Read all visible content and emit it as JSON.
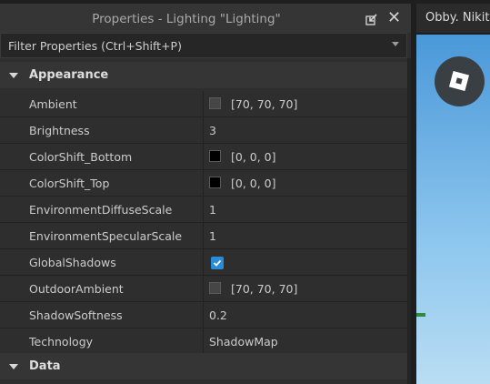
{
  "panel": {
    "title": "Properties - Lighting \"Lighting\"",
    "filter_placeholder": "Filter Properties (Ctrl+Shift+P)"
  },
  "sections": {
    "appearance": "Appearance",
    "data": "Data"
  },
  "properties": [
    {
      "name": "Ambient",
      "value": "[70, 70, 70]",
      "swatch": "#464646"
    },
    {
      "name": "Brightness",
      "value": "3"
    },
    {
      "name": "ColorShift_Bottom",
      "value": "[0, 0, 0]",
      "swatch": "#000000"
    },
    {
      "name": "ColorShift_Top",
      "value": "[0, 0, 0]",
      "swatch": "#000000"
    },
    {
      "name": "EnvironmentDiffuseScale",
      "value": "1"
    },
    {
      "name": "EnvironmentSpecularScale",
      "value": "1"
    },
    {
      "name": "GlobalShadows",
      "checked": true
    },
    {
      "name": "OutdoorAmbient",
      "value": "[70, 70, 70]",
      "swatch": "#464646"
    },
    {
      "name": "ShadowSoftness",
      "value": "0.2"
    },
    {
      "name": "Technology",
      "value": "ShadowMap"
    }
  ],
  "viewport": {
    "tab_title": "Obby. Nikit"
  },
  "colors": {
    "checkbox": "#2a8cd6",
    "panel_bg": "#2e2e2e"
  }
}
